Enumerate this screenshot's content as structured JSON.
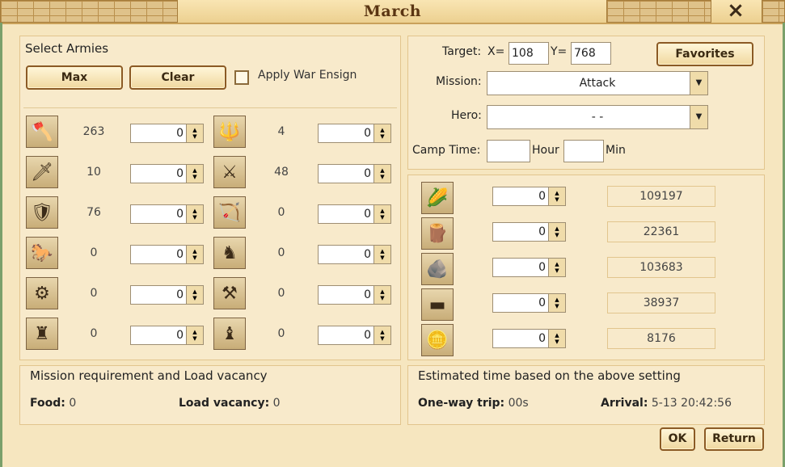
{
  "window": {
    "title": "March",
    "close_icon": "×"
  },
  "armies": {
    "heading": "Select Armies",
    "max_label": "Max",
    "clear_label": "Clear",
    "war_ensign_label": "Apply War Ensign",
    "left": [
      {
        "icon": "axe-icon",
        "glyph": "🪓",
        "count": "263",
        "value": "0"
      },
      {
        "icon": "sword-icon",
        "glyph": "🗡",
        "count": "10",
        "value": "0"
      },
      {
        "icon": "shield-icon",
        "glyph": "🛡",
        "count": "76",
        "value": "0"
      },
      {
        "icon": "horse-icon",
        "glyph": "🐎",
        "count": "0",
        "value": "0"
      },
      {
        "icon": "ballista-icon",
        "glyph": "⚙",
        "count": "0",
        "value": "0"
      },
      {
        "icon": "siege-tower-icon",
        "glyph": "♜",
        "count": "0",
        "value": "0"
      }
    ],
    "right": [
      {
        "icon": "trident-icon",
        "glyph": "🔱",
        "count": "4",
        "value": "0"
      },
      {
        "icon": "halberd-icon",
        "glyph": "⚔",
        "count": "48",
        "value": "0"
      },
      {
        "icon": "bow-icon",
        "glyph": "🏹",
        "count": "0",
        "value": "0"
      },
      {
        "icon": "armored-horse-icon",
        "glyph": "♞",
        "count": "0",
        "value": "0"
      },
      {
        "icon": "catapult-icon",
        "glyph": "⚒",
        "count": "0",
        "value": "0"
      },
      {
        "icon": "trebuchet-icon",
        "glyph": "♝",
        "count": "0",
        "value": "0"
      }
    ]
  },
  "target": {
    "label": "Target:",
    "x_label": "X=",
    "x_value": "108",
    "y_label": "Y=",
    "y_value": "768",
    "favorites_label": "Favorites",
    "mission_label": "Mission:",
    "mission_value": "Attack",
    "hero_label": "Hero:",
    "hero_value": "- -",
    "camp_label": "Camp Time:",
    "hour_label": "Hour",
    "min_label": "Min",
    "hour_value": "",
    "min_value": ""
  },
  "resources": [
    {
      "icon": "food-icon",
      "glyph": "🌽",
      "value": "0",
      "available": "109197"
    },
    {
      "icon": "lumber-icon",
      "glyph": "🪵",
      "value": "0",
      "available": "22361"
    },
    {
      "icon": "stone-icon",
      "glyph": "🪨",
      "value": "0",
      "available": "103683"
    },
    {
      "icon": "iron-icon",
      "glyph": "▬",
      "value": "0",
      "available": "38937"
    },
    {
      "icon": "gold-icon",
      "glyph": "🪙",
      "value": "0",
      "available": "8176"
    }
  ],
  "mission_req": {
    "heading": "Mission requirement and Load vacancy",
    "food_label": "Food:",
    "food_value": "0",
    "load_label": "Load vacancy:",
    "load_value": "0"
  },
  "estimate": {
    "heading": "Estimated time based on the above setting",
    "trip_label": "One-way trip:",
    "trip_value": "00s",
    "arrival_label": "Arrival:",
    "arrival_value": "5-13 20:42:56"
  },
  "footer": {
    "ok_label": "OK",
    "return_label": "Return"
  }
}
